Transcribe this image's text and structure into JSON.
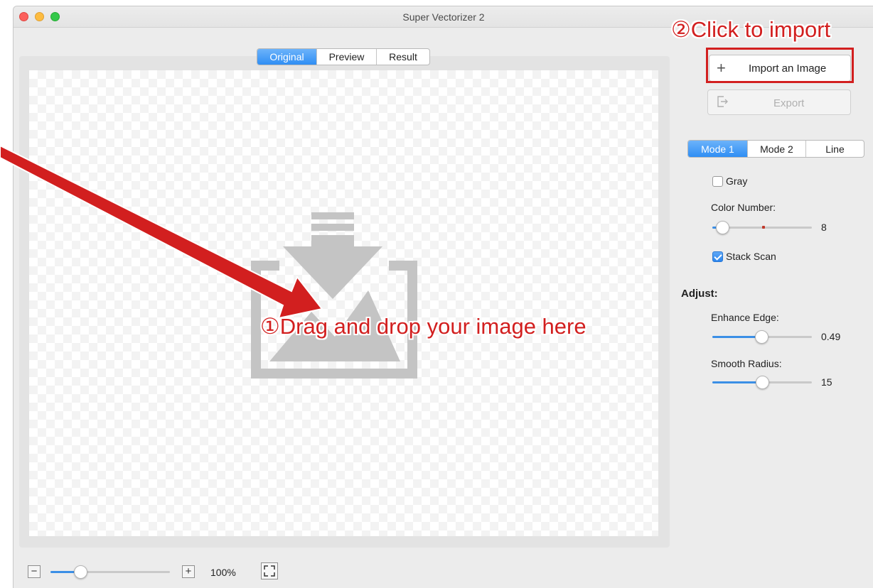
{
  "window": {
    "title": "Super Vectorizer 2"
  },
  "view_tabs": [
    {
      "label": "Original",
      "active": true
    },
    {
      "label": "Preview",
      "active": false
    },
    {
      "label": "Result",
      "active": false
    }
  ],
  "actions": {
    "import_label": "Import an Image",
    "import_icon": "plus-icon",
    "export_label": "Export",
    "export_icon": "export-icon",
    "export_enabled": false
  },
  "mode_tabs": [
    {
      "label": "Mode 1",
      "active": true
    },
    {
      "label": "Mode 2",
      "active": false
    },
    {
      "label": "Line",
      "active": false
    }
  ],
  "options": {
    "gray": {
      "label": "Gray",
      "checked": false
    },
    "color_number": {
      "label": "Color Number:",
      "value": "8",
      "level": 0.1
    },
    "stack_scan": {
      "label": "Stack Scan",
      "checked": true
    }
  },
  "adjust": {
    "title": "Adjust:",
    "enhance_edge": {
      "label": "Enhance Edge:",
      "value": "0.49",
      "level": 0.49
    },
    "smooth_radius": {
      "label": "Smooth Radius:",
      "value": "15",
      "level": 0.5
    }
  },
  "zoom": {
    "value": "100%",
    "level": 0.25
  },
  "annotations": {
    "import_hint": "②Click to import",
    "drop_hint": "①Drag and drop your image here"
  },
  "colors": {
    "accent": "#2f8ef4",
    "annotation_red": "#d21f1f",
    "drop_icon": "#c4c4c4"
  }
}
